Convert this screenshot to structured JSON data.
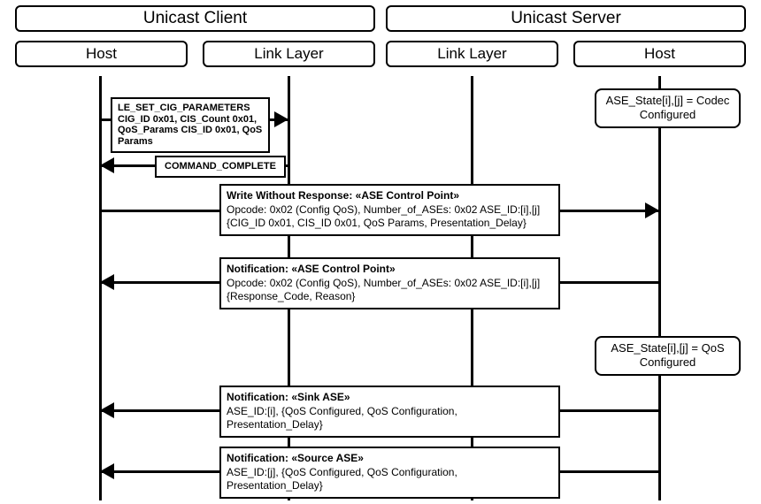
{
  "headers": {
    "client": "Unicast Client",
    "server": "Unicast Server",
    "host": "Host",
    "linklayer": "Link Layer"
  },
  "states": {
    "codec": "ASE_State[i],[j] = Codec Configured",
    "qos": "ASE_State[i],[j] = QoS Configured"
  },
  "msgs": {
    "cig": "LE_SET_CIG_PARAMETERS CIG_ID 0x01, CIS_Count 0x01, QoS_Params CIS_ID 0x01, QoS Params",
    "cmdcomplete": "COMMAND_COMPLETE",
    "write_title": "Write Without Response: «ASE Control Point»",
    "write_body": "Opcode: 0x02 (Config QoS), Number_of_ASEs: 0x02 ASE_ID:[i],[j] {CIG_ID 0x01, CIS_ID 0x01, QoS Params, Presentation_Delay}",
    "notif_cp_title": "Notification: «ASE Control Point»",
    "notif_cp_body": "Opcode: 0x02 (Config QoS), Number_of_ASEs: 0x02 ASE_ID:[i],[j] {Response_Code, Reason}",
    "notif_sink_title": "Notification: «Sink ASE»",
    "notif_sink_body": "ASE_ID:[i], {QoS Configured, QoS Configuration, Presentation_Delay}",
    "notif_src_title": "Notification: «Source ASE»",
    "notif_src_body": "ASE_ID:[j], {QoS Configured, QoS Configuration, Presentation_Delay}"
  }
}
